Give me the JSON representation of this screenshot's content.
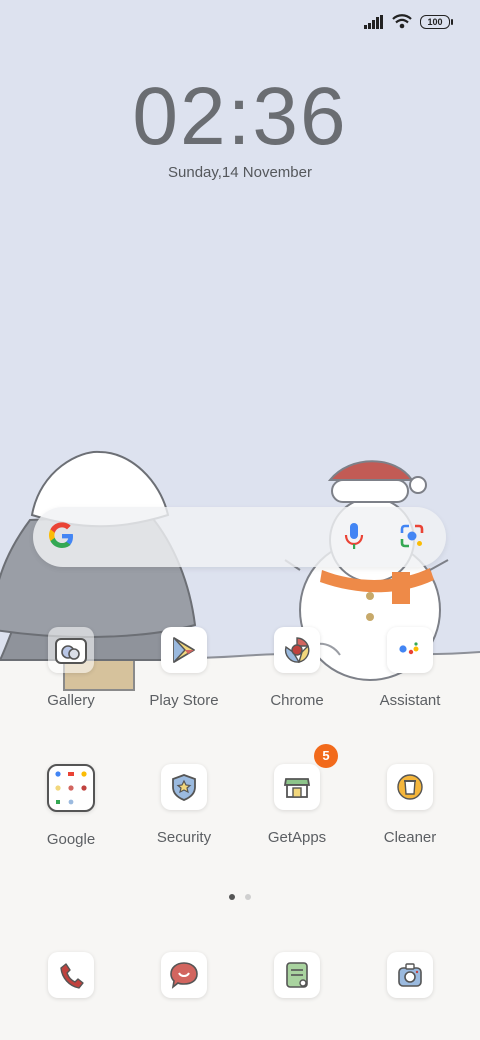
{
  "status": {
    "battery": "100"
  },
  "lockscreen": {
    "time": "02:36",
    "date": "Sunday,14 November"
  },
  "colors": {
    "sky": "#dde2ef",
    "ground": "#f7f6f4",
    "badge": "#f26a1b",
    "phone": "#c0423e"
  },
  "apps_row1": [
    {
      "label": "Gallery",
      "icon": "gallery-icon"
    },
    {
      "label": "Play Store",
      "icon": "play-store-icon"
    },
    {
      "label": "Chrome",
      "icon": "chrome-icon"
    },
    {
      "label": "Assistant",
      "icon": "assistant-icon"
    }
  ],
  "apps_row2": [
    {
      "label": "Google",
      "icon": "google-folder-icon"
    },
    {
      "label": "Security",
      "icon": "security-icon"
    },
    {
      "label": "GetApps",
      "icon": "getapps-icon",
      "badge": "5"
    },
    {
      "label": "Cleaner",
      "icon": "cleaner-icon"
    }
  ],
  "dock": [
    {
      "icon": "phone-icon"
    },
    {
      "icon": "messages-icon"
    },
    {
      "icon": "notes-icon"
    },
    {
      "icon": "camera-icon"
    }
  ],
  "pages": {
    "count": 2,
    "active": 0
  }
}
